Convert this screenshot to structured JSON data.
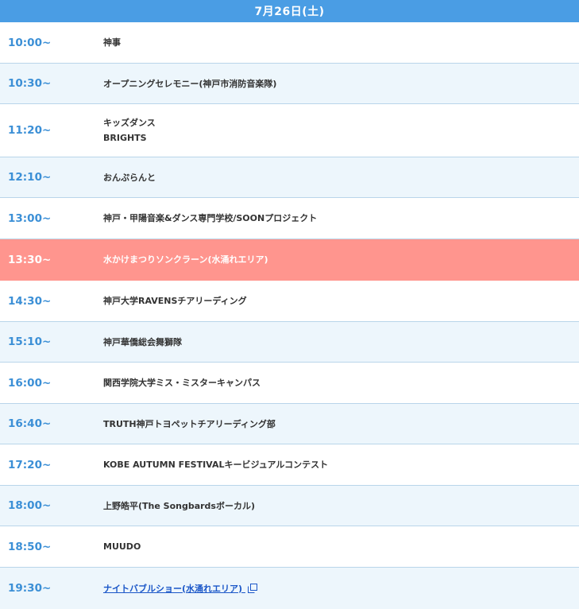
{
  "header": {
    "date": "7月26日(土)"
  },
  "rows": [
    {
      "time": "10:00~",
      "lines": [
        "神事"
      ]
    },
    {
      "time": "10:30~",
      "lines": [
        "オープニングセレモニー(神戸市消防音楽隊)"
      ]
    },
    {
      "time": "11:20~",
      "lines": [
        "キッズダンス",
        "BRIGHTS"
      ]
    },
    {
      "time": "12:10~",
      "lines": [
        "おんぷらんと"
      ]
    },
    {
      "time": "13:00~",
      "lines": [
        "神戸・甲陽音楽&ダンス専門学校/SOONプロジェクト"
      ]
    },
    {
      "time": "13:30~",
      "lines": [
        "水かけまつりソンクラーン(水涌れエリア)"
      ]
    },
    {
      "time": "14:30~",
      "lines": [
        "神戸大学RAVENSチアリーディング"
      ]
    },
    {
      "time": "15:10~",
      "lines": [
        "神戸華僑総会舞獅隊"
      ]
    },
    {
      "time": "16:00~",
      "lines": [
        "関西学院大学ミス・ミスターキャンパス"
      ]
    },
    {
      "time": "16:40~",
      "lines": [
        "TRUTH神戸トヨペットチアリーディング部"
      ]
    },
    {
      "time": "17:20~",
      "lines": [
        "KOBE AUTUMN FESTIVALキービジュアルコンテスト"
      ]
    },
    {
      "time": "18:00~",
      "lines": [
        "上野皓平(The Songbardsボーカル)"
      ]
    },
    {
      "time": "18:50~",
      "lines": [
        "MUUDO"
      ]
    },
    {
      "time": "19:30~",
      "lines": [
        "ナイトバブルショー(水涌れエリア)"
      ]
    }
  ],
  "icons": {
    "external_link": "external-link-icon"
  },
  "colors": {
    "header_bg": "#4a9de4",
    "time_text": "#3b8fd6",
    "highlight_bg": "#ff958e",
    "row_alt_bg": "#edf6fc",
    "link": "#1a56c8"
  }
}
